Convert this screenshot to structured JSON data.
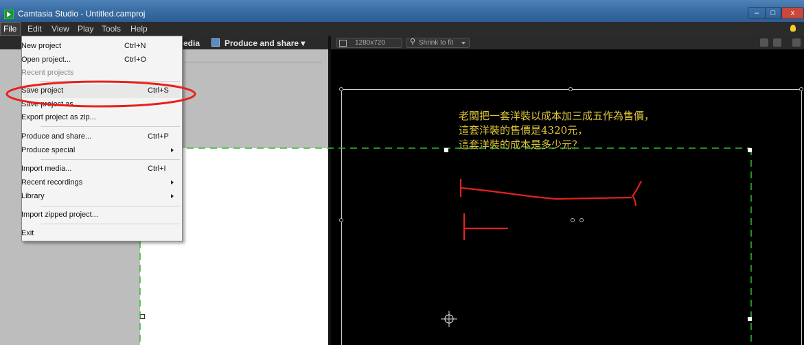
{
  "window": {
    "title": "Camtasia Studio - Untitled.camproj",
    "minimize": "–",
    "maximize": "□",
    "close": "x"
  },
  "menubar": [
    "File",
    "Edit",
    "View",
    "Play",
    "Tools",
    "Help"
  ],
  "left_toolbar": {
    "media_tab_partial": "edia",
    "produce_tab": "Produce and share ▾"
  },
  "preview_toolbar": {
    "resolution": "1280x720",
    "zoom": "Shrink to fit"
  },
  "file_menu": {
    "items": [
      {
        "label": "New project",
        "shortcut": "Ctrl+N"
      },
      {
        "label": "Open project...",
        "shortcut": "Ctrl+O"
      },
      {
        "label": "Recent projects",
        "disabled": true
      },
      {
        "label": "Save project",
        "shortcut": "Ctrl+S"
      },
      {
        "label": "Save project as..."
      },
      {
        "label": "Export project as zip..."
      },
      {
        "label": "Produce and share...",
        "shortcut": "Ctrl+P"
      },
      {
        "label": "Produce special",
        "submenu": true
      },
      {
        "label": "Import media...",
        "shortcut": "Ctrl+I"
      },
      {
        "label": "Recent recordings",
        "submenu": true
      },
      {
        "label": "Library",
        "submenu": true
      },
      {
        "label": "Import zipped project..."
      },
      {
        "label": "Exit"
      }
    ]
  },
  "canvas_text": {
    "line1": "老闆把一套洋裝以成本加三成五作為售價，",
    "line2": "這套洋裝的售價是4320元，",
    "line3": "這套洋裝的成本是多少元？"
  },
  "colors": {
    "canvas_text": "#e0c63a",
    "annotation_red": "#e8201c",
    "guide_green": "#2fbf2f"
  }
}
